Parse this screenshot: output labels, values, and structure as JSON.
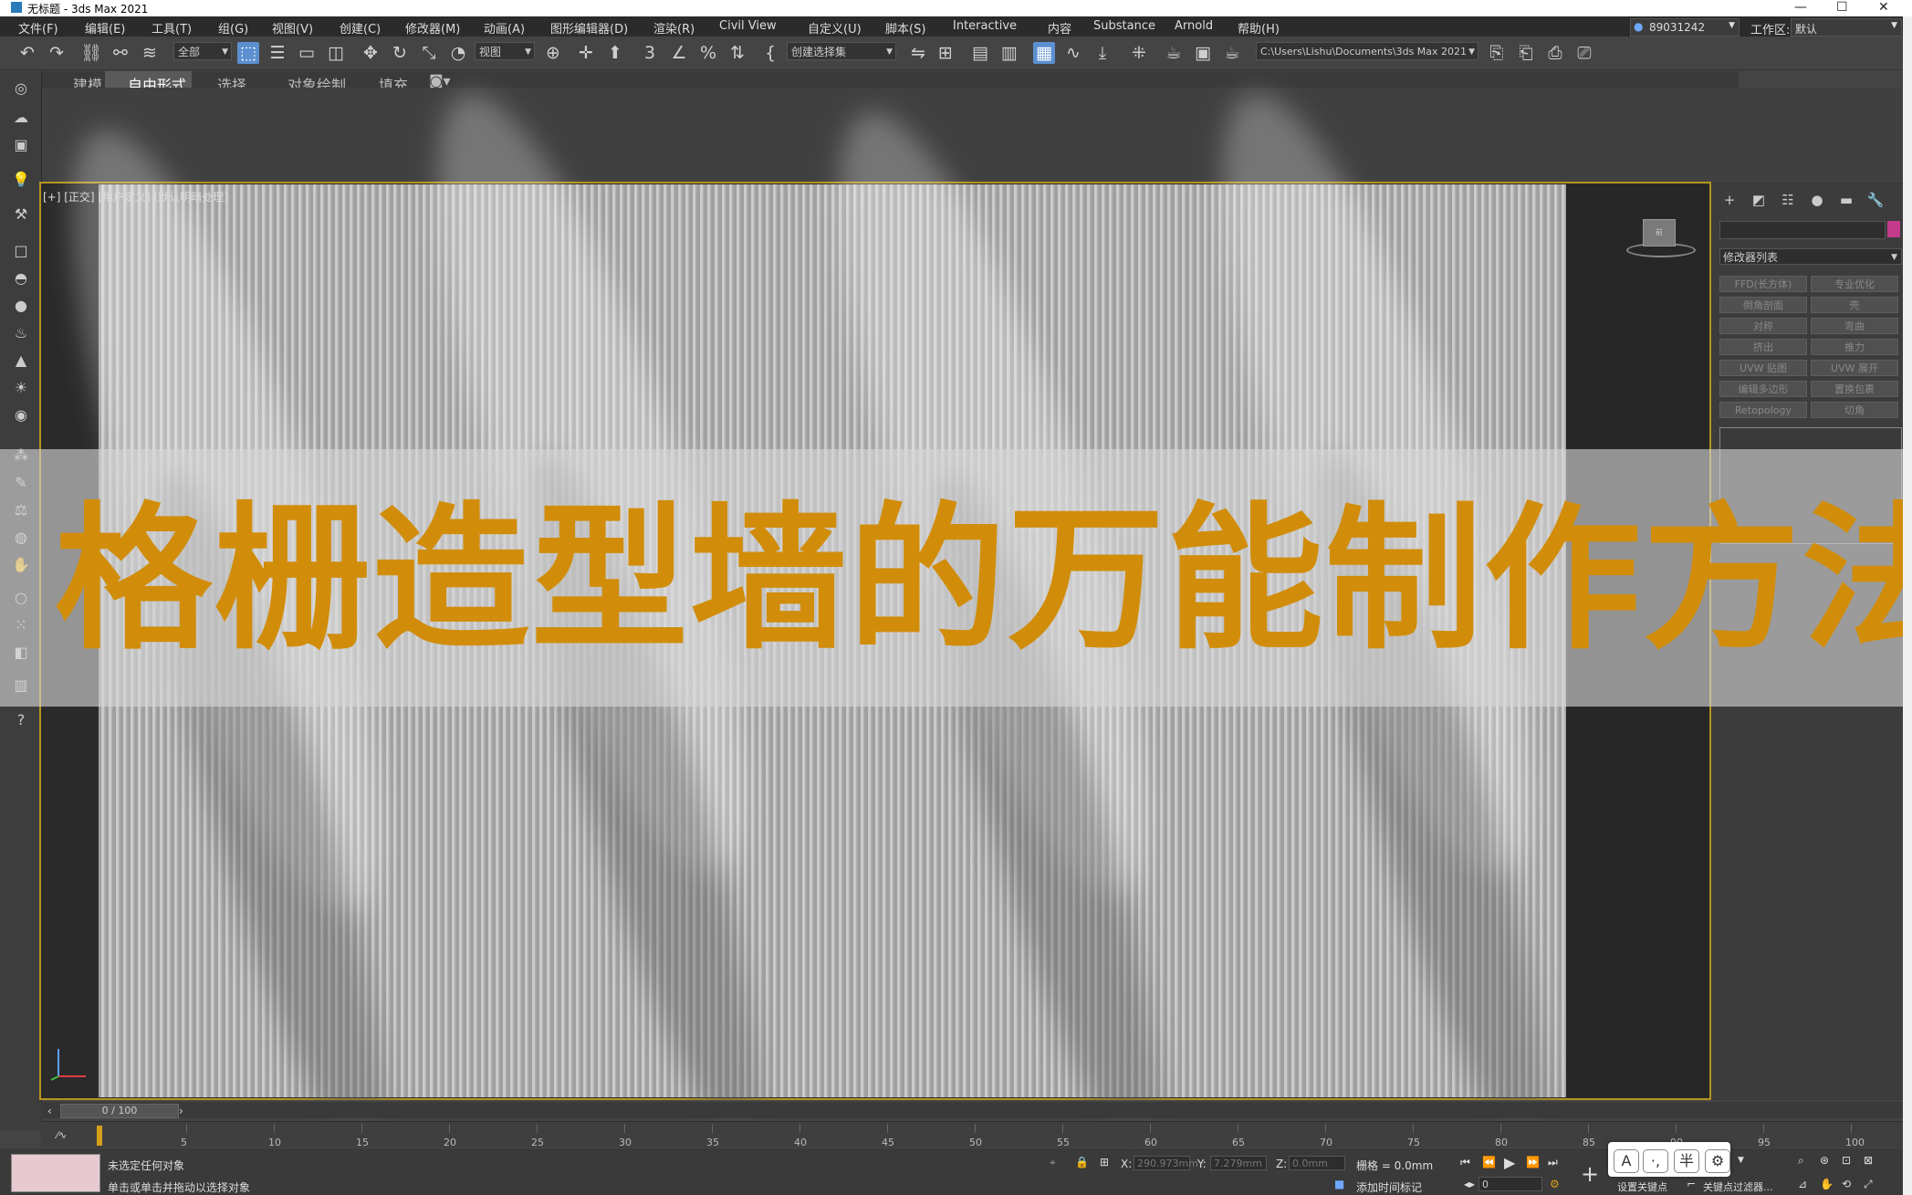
{
  "window": {
    "title": "无标题 - 3ds Max 2021",
    "controls": [
      "—",
      "☐",
      "✕"
    ]
  },
  "menubar": {
    "items": [
      "文件(F)",
      "编辑(E)",
      "工具(T)",
      "组(G)",
      "视图(V)",
      "创建(C)",
      "修改器(M)",
      "动画(A)",
      "图形编辑器(D)",
      "渲染(R)",
      "Civil View",
      "自定义(U)",
      "脚本(S)",
      "Interactive",
      "内容",
      "Substance",
      "Arnold",
      "帮助(H)"
    ],
    "user_id": "89031242",
    "workspace_label": "工作区:",
    "workspace_value": "默认"
  },
  "toolbar": {
    "selection_filter": "全部",
    "ref_coord": "视图",
    "named_selection": "创建选择集",
    "project_path": "C:\\Users\\Lishu\\Documents\\3ds Max 2021"
  },
  "ribbon": {
    "tabs": [
      "建模",
      "自由形式",
      "选择",
      "对象绘制",
      "填充"
    ],
    "active_tab": "自由形式"
  },
  "viewport": {
    "label": "[+] [正交] [用户定义] [默认明暗处理]",
    "viewcube_label": "前"
  },
  "banner": {
    "text": "格栅造型墙的万能制作方法"
  },
  "command_panel": {
    "modifier_list": "修改器列表",
    "buttons": [
      "FFD(长方体)",
      "专业优化",
      "倒角剖面",
      "壳",
      "对称",
      "弯曲",
      "挤出",
      "推力",
      "UVW 贴图",
      "UVW 展开",
      "编辑多边形",
      "置换包裹",
      "Retopology",
      "切角"
    ]
  },
  "timeline": {
    "frame": "0 / 100",
    "ticks": [
      "5",
      "10",
      "15",
      "20",
      "25",
      "30",
      "35",
      "40",
      "45",
      "50",
      "55",
      "60",
      "65",
      "70",
      "75",
      "80",
      "85",
      "90",
      "95",
      "100"
    ]
  },
  "status": {
    "selection": "未选定任何对象",
    "prompt": "单击或单击并拖动以选择对象",
    "x_label": "X:",
    "x_value": "290.973mm",
    "y_label": "Y:",
    "y_value": "7.279mm",
    "z_label": "Z:",
    "z_value": "0.0mm",
    "grid": "栅格 = 0.0mm",
    "add_time_tag": "添加时间标记",
    "set_key": "设置关键点",
    "key_filters": "关键点过滤器...",
    "frame_field": "0"
  },
  "ime": {
    "buttons": [
      "A",
      "·,",
      "半",
      "⚙"
    ]
  },
  "colors": {
    "banner_text": "#d18d0a",
    "viewport_border": "#b5951e",
    "selected_tool": "#5b8fd0",
    "object_color": "#c43b8c"
  }
}
